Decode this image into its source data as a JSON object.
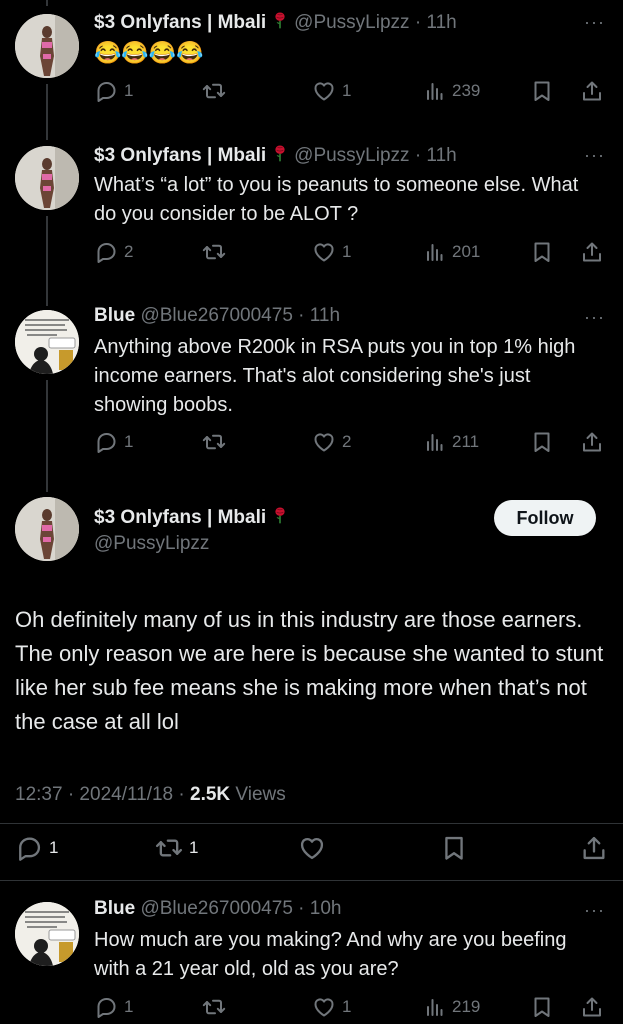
{
  "tweets": [
    {
      "name": "$3 Onlyfans | Mbali",
      "handle": "@PussyLipzz",
      "time": "· 11h",
      "text": "😂😂😂😂",
      "replies": "1",
      "retweets": "",
      "likes": "1",
      "views": "239"
    },
    {
      "name": "$3 Onlyfans | Mbali",
      "handle": "@PussyLipzz",
      "time": "· 11h",
      "text": "What’s “a lot” to you is peanuts to someone else. What do you consider to be ALOT ?",
      "replies": "2",
      "retweets": "",
      "likes": "1",
      "views": "201"
    },
    {
      "name": "Blue",
      "handle": "@Blue267000475",
      "time": "· 11h",
      "text": "Anything above R200k in RSA puts you in top 1% high income earners. That's alot considering she's just showing boobs.",
      "replies": "1",
      "retweets": "",
      "likes": "2",
      "views": "211"
    }
  ],
  "main_tweet": {
    "name": "$3 Onlyfans | Mbali",
    "handle": "@PussyLipzz",
    "follow_label": "Follow",
    "text": "Oh definitely many of us in this industry are those earners. The only reason we are here is because she wanted to stunt like her sub fee means she is making more when that’s not the case at all lol",
    "time": "12:37 · 2024/11/18 · ",
    "views_count": "2.5K",
    "views_label": "Views",
    "replies": "1",
    "retweets": "1"
  },
  "reply": {
    "name": "Blue",
    "handle": "@Blue267000475",
    "time": "· 10h",
    "text": "How much are you making? And why are you beefing with a 21 year old, old as you are?",
    "replies": "1",
    "retweets": "",
    "likes": "1",
    "views": "219"
  },
  "more_label": "···",
  "colors": {
    "background": "#000000",
    "text": "#e7e9ea",
    "secondary": "#71767b",
    "rose": "#c8102e",
    "follow_bg": "#eff3f4"
  },
  "icons": [
    "reply-icon",
    "retweet-icon",
    "like-icon",
    "views-icon",
    "bookmark-icon",
    "share-icon",
    "rose-emoji",
    "more-icon"
  ]
}
